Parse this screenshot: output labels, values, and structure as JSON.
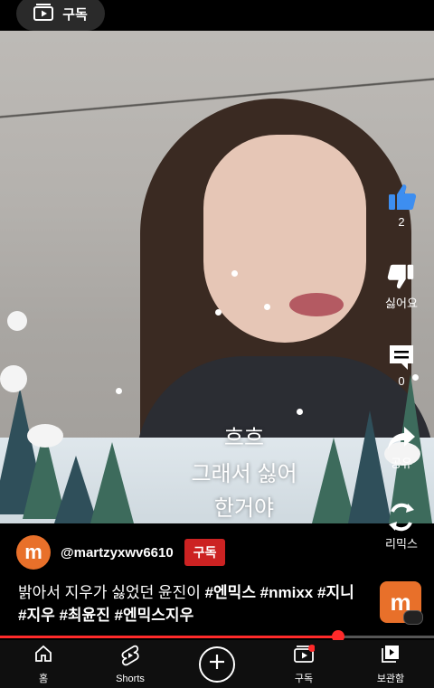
{
  "top_bar": {
    "subscriptions_label": "구독"
  },
  "video": {
    "captions": [
      "흐흐",
      "그래서 싫어",
      "한거야"
    ]
  },
  "actions": {
    "like_count": "2",
    "dislike_label": "싫어요",
    "comment_count": "0",
    "share_label": "공유",
    "remix_label": "리믹스"
  },
  "channel": {
    "avatar_letter": "m",
    "handle": "@martzyxwv6610",
    "subscribe_label": "구독"
  },
  "description": {
    "plain": "밝아서  지우가 싫었던 윤진이 ",
    "hashtags_line": "#엔믹스 #nmixx #지니 #지우 #최윤진 #엔믹스지우"
  },
  "thumbnail": {
    "letter": "m"
  },
  "progress": {
    "fraction": 0.78
  },
  "nav": {
    "items": [
      {
        "label": "홈"
      },
      {
        "label": "Shorts"
      },
      {
        "label": ""
      },
      {
        "label": "구독"
      },
      {
        "label": "보관함"
      }
    ]
  },
  "colors": {
    "accent": "#ff2a2a",
    "subscribe": "#cc2222",
    "avatar": "#e8702a",
    "like": "#3d8ef0"
  }
}
